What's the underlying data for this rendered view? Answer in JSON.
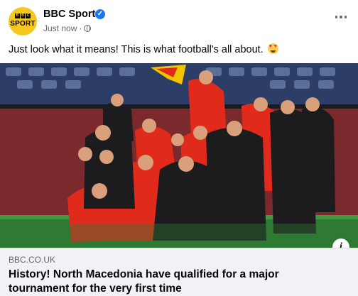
{
  "post": {
    "page_name": "BBC Sport",
    "time": "Just now",
    "separator": "·",
    "caption": "Just look what it means! This is what football's all about.",
    "avatar": {
      "bbc_letters": [
        "B",
        "B",
        "C"
      ],
      "sport_text": "SPORT"
    },
    "link": {
      "domain": "BBC.CO.UK",
      "headline": "History! North Macedonia have qualified for a major tournament for the very first time"
    },
    "icons": {
      "verified": "verified-badge-icon",
      "audience": "globe-icon",
      "more": "more-options-icon",
      "info": "info-icon",
      "emoji": "heart-eyes-emoji-icon"
    },
    "colors": {
      "brand_yellow": "#f6c71e",
      "verified_blue": "#1877f2",
      "kit_red": "#e02a1c",
      "text_secondary": "#65676b",
      "link_box_bg": "#f0f2f5"
    }
  }
}
